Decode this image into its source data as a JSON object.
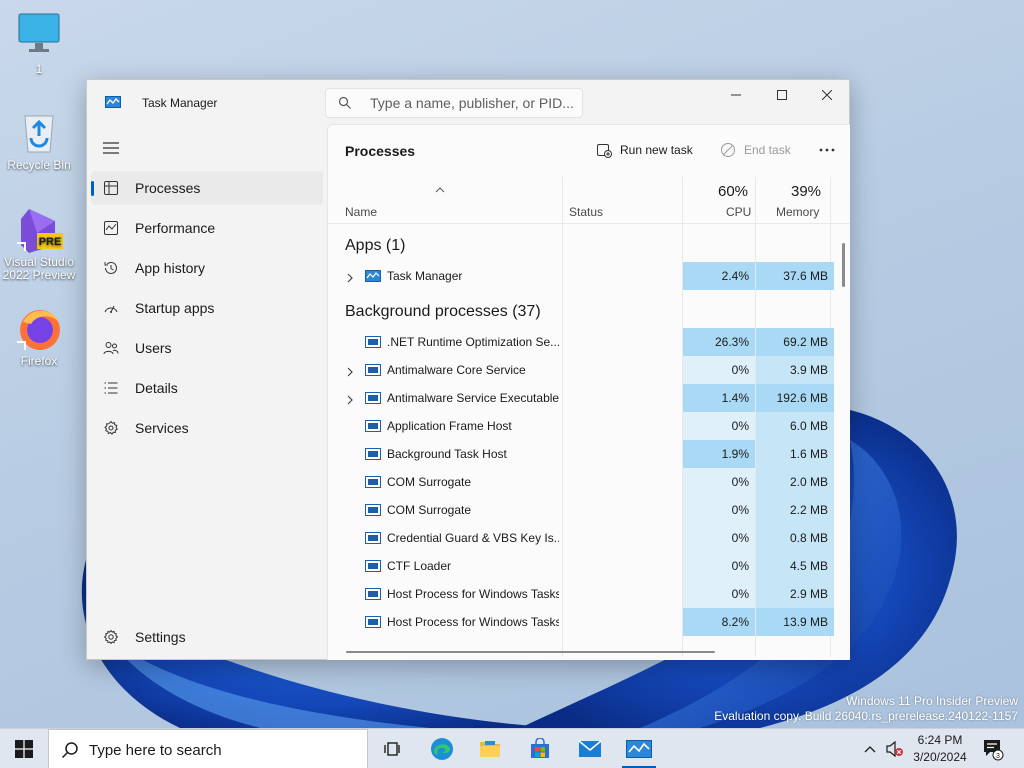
{
  "desktop": {
    "icons": [
      {
        "label": "1"
      },
      {
        "label": "Recycle Bin"
      },
      {
        "label": "Visual Studio 2022 Preview",
        "badge": "PRE"
      },
      {
        "label": "Firefox"
      }
    ],
    "watermark_line1": "Windows 11 Pro Insider Preview",
    "watermark_line2": "Evaluation copy. Build 26040.rs_prerelease.240122-1157"
  },
  "window": {
    "title": "Task Manager",
    "search_placeholder": "Type a name, publisher, or PID..."
  },
  "sidebar": {
    "items": [
      {
        "label": "Processes",
        "icon": "processes-icon",
        "active": true
      },
      {
        "label": "Performance",
        "icon": "performance-icon"
      },
      {
        "label": "App history",
        "icon": "history-icon"
      },
      {
        "label": "Startup apps",
        "icon": "startup-icon"
      },
      {
        "label": "Users",
        "icon": "users-icon"
      },
      {
        "label": "Details",
        "icon": "details-icon"
      },
      {
        "label": "Services",
        "icon": "services-icon"
      }
    ],
    "settings_label": "Settings"
  },
  "content": {
    "title": "Processes",
    "run_new_task": "Run new task",
    "end_task": "End task",
    "columns": {
      "name": "Name",
      "status": "Status",
      "cpu_pct": "60%",
      "cpu": "CPU",
      "mem_pct": "39%",
      "memory": "Memory"
    },
    "apps_group": "Apps (1)",
    "apps": [
      {
        "name": "Task Manager",
        "cpu": "2.4%",
        "mem": "37.6 MB",
        "expandable": true
      }
    ],
    "bg_group": "Background processes (37)",
    "background": [
      {
        "name": ".NET Runtime Optimization Se...",
        "cpu": "26.3%",
        "mem": "69.2 MB",
        "expandable": false
      },
      {
        "name": "Antimalware Core Service",
        "cpu": "0%",
        "mem": "3.9 MB",
        "expandable": true
      },
      {
        "name": "Antimalware Service Executable",
        "cpu": "1.4%",
        "mem": "192.6 MB",
        "expandable": true
      },
      {
        "name": "Application Frame Host",
        "cpu": "0%",
        "mem": "6.0 MB",
        "expandable": false
      },
      {
        "name": "Background Task Host",
        "cpu": "1.9%",
        "mem": "1.6 MB",
        "expandable": false
      },
      {
        "name": "COM Surrogate",
        "cpu": "0%",
        "mem": "2.0 MB",
        "expandable": false
      },
      {
        "name": "COM Surrogate",
        "cpu": "0%",
        "mem": "2.2 MB",
        "expandable": false
      },
      {
        "name": "Credential Guard & VBS Key Is...",
        "cpu": "0%",
        "mem": "0.8 MB",
        "expandable": false
      },
      {
        "name": "CTF Loader",
        "cpu": "0%",
        "mem": "4.5 MB",
        "expandable": false
      },
      {
        "name": "Host Process for Windows Tasks",
        "cpu": "0%",
        "mem": "2.9 MB",
        "expandable": false
      },
      {
        "name": "Host Process for Windows Tasks",
        "cpu": "8.2%",
        "mem": "13.9 MB",
        "expandable": false
      }
    ]
  },
  "taskbar": {
    "search_placeholder": "Type here to search",
    "time": "6:24 PM",
    "date": "3/20/2024",
    "notification_count": "3"
  },
  "colors": {
    "accent": "#005fb8",
    "cpu_heat_low": "#dff0fb",
    "cpu_heat_mid": "#c6e6f8",
    "cpu_heat_high": "#a9d9f5"
  }
}
